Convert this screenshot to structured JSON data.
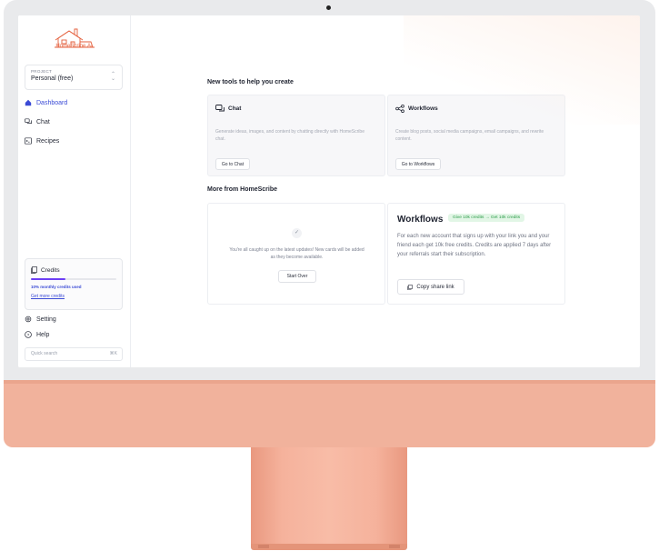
{
  "sidebar": {
    "logo_text": "HomeScribe.AI",
    "project_label": "PROJECT",
    "project_value": "Personal (free)",
    "nav": [
      {
        "label": "Dashboard",
        "icon": "house-icon",
        "active": true
      },
      {
        "label": "Chat",
        "icon": "chat-bubbles-icon"
      },
      {
        "label": "Recipes",
        "icon": "terminal-icon"
      }
    ],
    "credits": {
      "title": "Credits",
      "progress": 0.4,
      "used_text": "10% monthly credits used",
      "more_link": "Get more credits"
    },
    "setting": "Setting",
    "help": "Help",
    "search_placeholder": "Quick search",
    "search_shortcut": "⌘K"
  },
  "main": {
    "tools_heading": "New tools to help you create",
    "chat_card": {
      "title": "Chat",
      "description": "Generate ideas, images, and content by chatting directly with HomeScribe chat.",
      "button": "Go to Chat"
    },
    "workflows_card": {
      "title": "Workflows",
      "description": "Create blog posts, social media campaigns, email campaigns, and rewrite content.",
      "button": "Go to Workflows"
    },
    "more_heading": "More from HomeScribe",
    "updates_card": {
      "message": "You're all caught up on the latest updates! New cards will be added as they become available.",
      "button": "Start Over"
    },
    "referral_card": {
      "title": "Workflows",
      "badge": "Give 10k credits → Get 10k credits",
      "text": "For each new account that signs up with your link you and your friend each get 10k free credits. Credits are applied 7 days after your referrals start their subscription.",
      "button": "Copy share link"
    }
  },
  "colors": {
    "accent": "#3b4bd6",
    "brand": "#e45f3c",
    "frame_orange": "#f1b29c"
  }
}
